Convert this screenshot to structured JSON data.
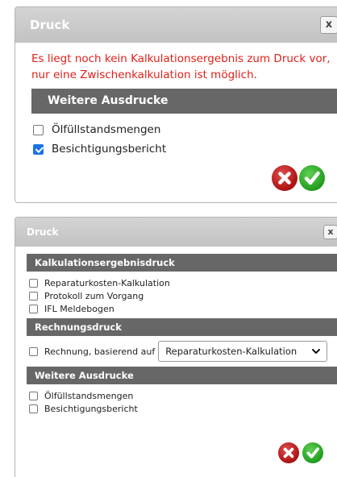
{
  "dialog1": {
    "title": "Druck",
    "close_label": "x",
    "warning_line1": "Es liegt noch kein Kalkulationsergebnis zum Druck vor,",
    "warning_line2": "nur eine Zwischenkalkulation ist möglich.",
    "section_title": "Weitere Ausdrucke",
    "items": [
      {
        "label": "Ölfüllstandsmengen",
        "checked": false
      },
      {
        "label": "Besichtigungsbericht",
        "checked": true
      }
    ],
    "cancel_icon": "cancel-x-icon",
    "ok_icon": "confirm-check-icon"
  },
  "dialog2": {
    "title": "Druck",
    "close_label": "x",
    "sections": {
      "kalkulation": {
        "title": "Kalkulationsergebnisdruck",
        "items": [
          {
            "label": "Reparaturkosten-Kalkulation",
            "checked": false
          },
          {
            "label": "Protokoll zum Vorgang",
            "checked": false
          },
          {
            "label": "IFL Meldebogen",
            "checked": false
          }
        ]
      },
      "rechnung": {
        "title": "Rechnungsdruck",
        "checkbox_label": "Rechnung, basierend auf",
        "checked": false,
        "select_value": "Reparaturkosten-Kalkulation"
      },
      "weitere": {
        "title": "Weitere Ausdrucke",
        "items": [
          {
            "label": "Ölfüllstandsmengen",
            "checked": false
          },
          {
            "label": "Besichtigungsbericht",
            "checked": false
          }
        ]
      }
    }
  },
  "colors": {
    "warning": "#e0201a",
    "section_bg": "#676767",
    "titlebar_bg": "#c8c8c8",
    "checkbox_checked": "#1a73e8",
    "cancel_red": "#c0181a",
    "ok_green": "#2aa526"
  }
}
